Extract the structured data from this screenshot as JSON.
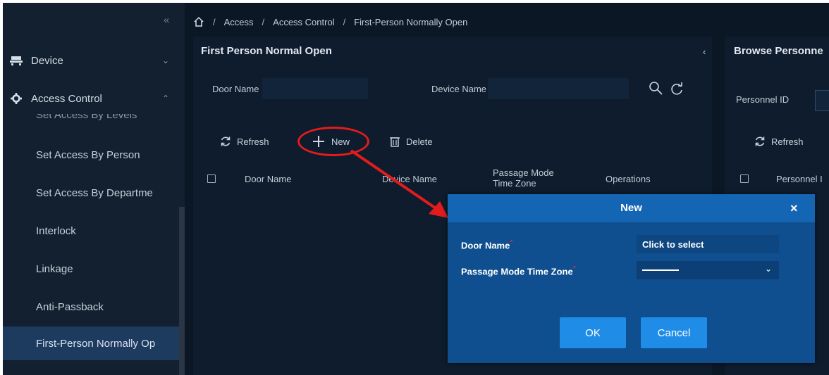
{
  "sidebar": {
    "sections": [
      {
        "label": "Device",
        "icon": "device-icon",
        "chevron": "chevron-down-icon"
      },
      {
        "label": "Access Control",
        "icon": "gear-icon",
        "chevron": "chevron-up-icon"
      }
    ],
    "clipped_item": "Set Access By Levels",
    "items": [
      {
        "label": "Set Access By Person"
      },
      {
        "label": "Set Access By Departme"
      },
      {
        "label": "Interlock"
      },
      {
        "label": "Linkage"
      },
      {
        "label": "Anti-Passback"
      },
      {
        "label": "First-Person Normally Op"
      }
    ],
    "active_item": "First-Person Normally Op"
  },
  "breadcrumb": {
    "separator": "/",
    "items": [
      "Access",
      "Access Control",
      "First-Person Normally Open"
    ]
  },
  "main": {
    "title": "First Person Normal Open",
    "filters": {
      "door_name_label": "Door Name",
      "device_name_label": "Device Name"
    },
    "toolbar": {
      "refresh": "Refresh",
      "new": "New",
      "delete": "Delete"
    },
    "table": {
      "columns": [
        "Door Name",
        "Device Name",
        "Passage Mode Time Zone",
        "Operations"
      ],
      "passage_col_line1": "Passage Mode",
      "passage_col_line2": "Time Zone"
    }
  },
  "right_panel": {
    "title": "Browse Personne",
    "personnel_id_label": "Personnel ID",
    "refresh": "Refresh",
    "column": "Personnel I"
  },
  "dialog": {
    "title": "New",
    "door_name_label": "Door Name",
    "door_name_value": "Click to select",
    "time_zone_label": "Passage Mode Time Zone",
    "required_mark": "*",
    "ok": "OK",
    "cancel": "Cancel"
  },
  "colors": {
    "app_background": "#0c1725",
    "sidebar_background": "#12202f",
    "active_item": "#1d3a5f",
    "dialog_body": "#0f4f8f",
    "dialog_header": "#1466b4",
    "button": "#1f8de8",
    "annotation_red": "#e21c1c"
  }
}
